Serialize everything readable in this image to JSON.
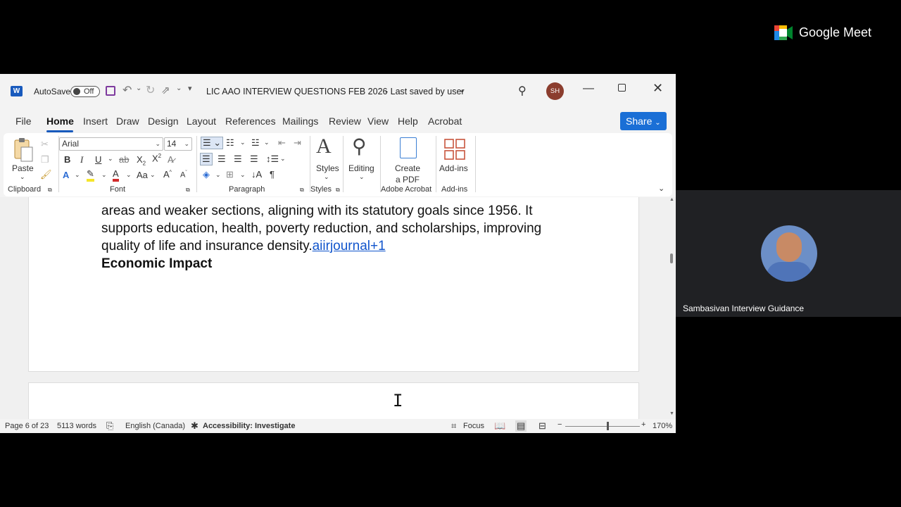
{
  "word": {
    "app_logo": "W",
    "autosave_label": "AutoSave",
    "autosave_state": "Off",
    "doc_title": "LIC AAO INTERVIEW QUESTIONS FEB 2026",
    "saved_status": "-  Last saved by user",
    "avatar_initials": "SH",
    "tabs": [
      "File",
      "Home",
      "Insert",
      "Draw",
      "Design",
      "Layout",
      "References",
      "Mailings",
      "Review",
      "View",
      "Help",
      "Acrobat"
    ],
    "share_label": "Share",
    "ribbon": {
      "clipboard": {
        "paste_label": "Paste",
        "group_label": "Clipboard"
      },
      "font": {
        "font_name": "Arial",
        "font_size": "14",
        "group_label": "Font"
      },
      "paragraph": {
        "group_label": "Paragraph"
      },
      "styles": {
        "label": "Styles",
        "group_label": "Styles"
      },
      "editing": {
        "label": "Editing"
      },
      "acrobat": {
        "label_line1": "Create",
        "label_line2": "a PDF",
        "group_label": "Adobe Acrobat"
      },
      "addins": {
        "label": "Add-ins",
        "group_label": "Add-ins"
      }
    },
    "document": {
      "lines": [
        "areas and weaker sections, aligning with its statutory goals since 1956. It",
        "supports education, health, poverty reduction, and scholarships, improving",
        "quality of life and insurance density."
      ],
      "link_text": "aiirjournal+1",
      "heading": "Economic Impact"
    },
    "status": {
      "page": "Page 6 of 23",
      "words": "5113 words",
      "language": "English (Canada)",
      "accessibility": "Accessibility: Investigate",
      "focus": "Focus",
      "zoom": "170%"
    }
  },
  "meet": {
    "brand": "Google Meet",
    "participant_name": "Sambasivan Interview Guidance"
  }
}
